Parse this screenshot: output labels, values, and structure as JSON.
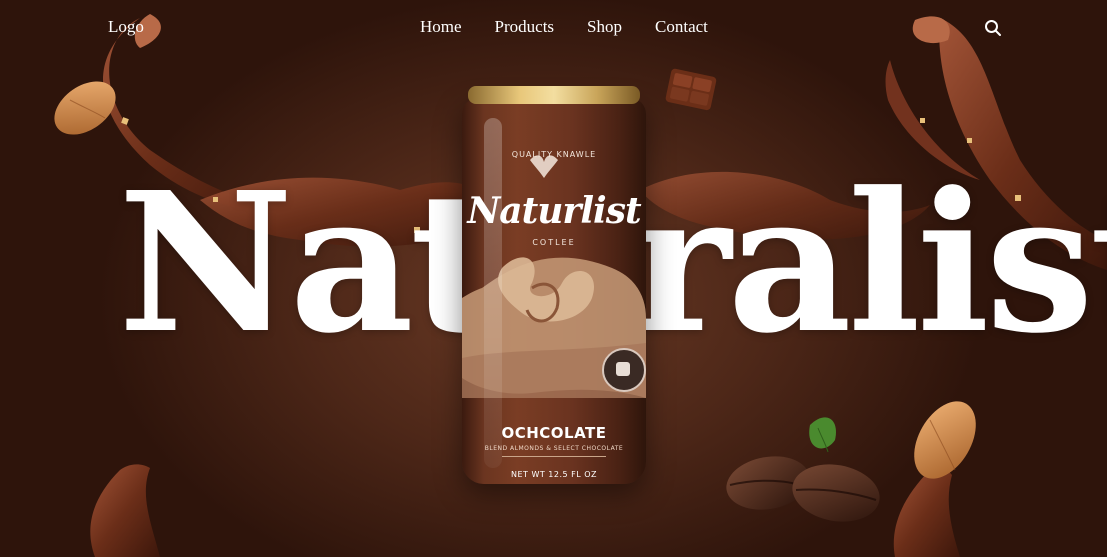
{
  "nav": {
    "logo": "Logo",
    "items": [
      {
        "label": "Home"
      },
      {
        "label": "Products"
      },
      {
        "label": "Shop"
      },
      {
        "label": "Contact"
      }
    ],
    "search_icon": "search-icon"
  },
  "hero": {
    "title": "Naturalist",
    "product": {
      "top_text": "QUALITY KNAWLE",
      "brand": "Naturlist",
      "subtitle": "COTLEE",
      "flavor": "OCHCOLATE",
      "description": "BLEND ALMONDS & SELECT CHOCOLATE",
      "net": "NET WT 12.5 FL OZ"
    }
  },
  "colors": {
    "background": "#3a1a0e",
    "chocolate": "#6b3520",
    "text": "#ffffff"
  }
}
